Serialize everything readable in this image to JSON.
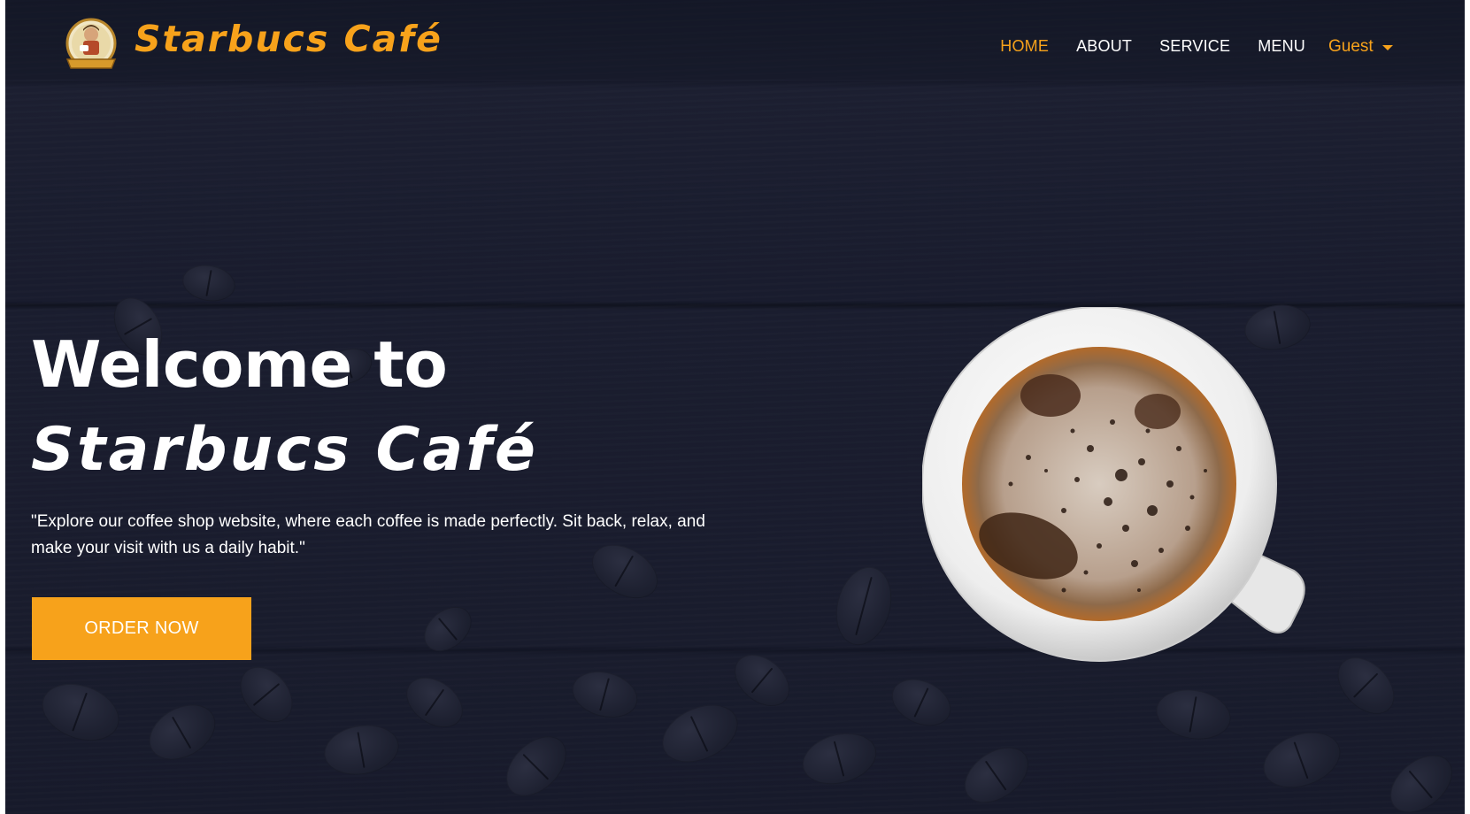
{
  "brand": {
    "name": "Starbucs Café",
    "logo_icon": "barista-logo-icon"
  },
  "nav": {
    "items": [
      {
        "label": "HOME",
        "active": true
      },
      {
        "label": "ABOUT",
        "active": false
      },
      {
        "label": "SERVICE",
        "active": false
      },
      {
        "label": "MENU",
        "active": false
      }
    ],
    "user": {
      "label": "Guest",
      "icon": "caret-down-icon"
    }
  },
  "hero": {
    "title_line1": "Welcome to",
    "title_line2": "Starbucs Café",
    "description": "\"Explore our coffee shop website, where each coffee is made perfectly. Sit back, relax, and make your visit with us a daily habit.\"",
    "cta_label": "ORDER NOW",
    "image_icon": "coffee-cup-image"
  },
  "colors": {
    "accent": "#f7a21b",
    "background": "#171a2b",
    "text": "#ffffff"
  }
}
